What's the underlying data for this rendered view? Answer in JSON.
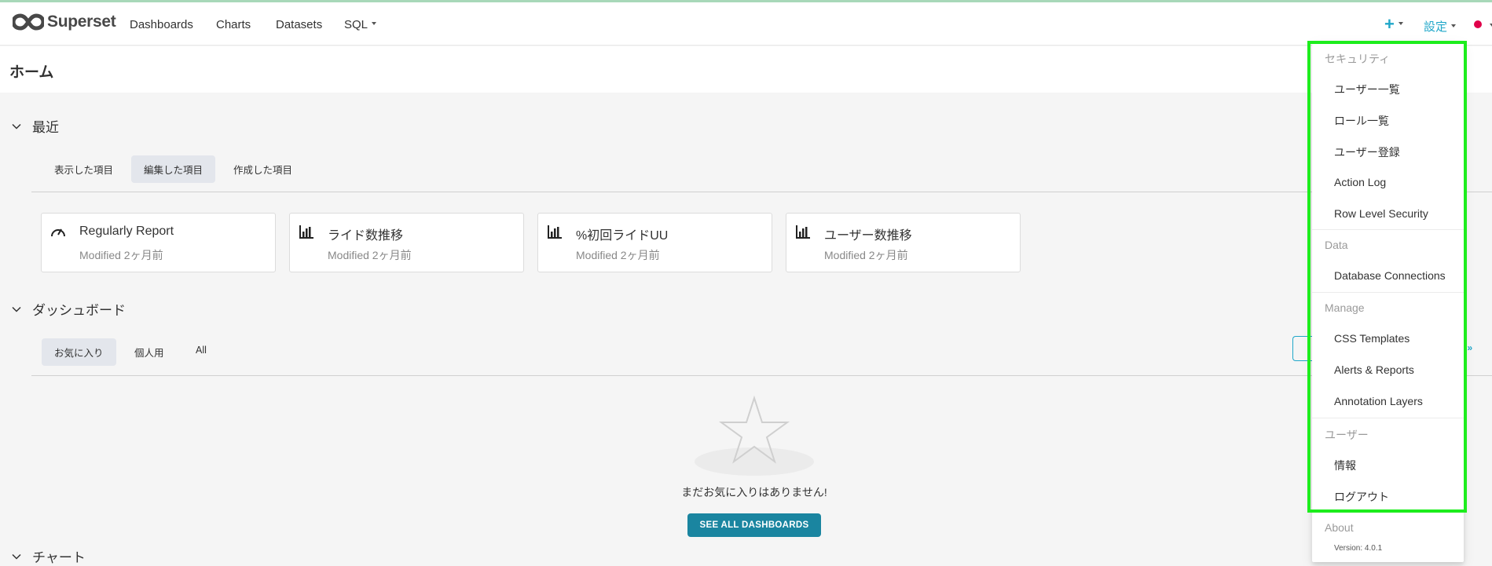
{
  "brand": {
    "name": "Superset"
  },
  "nav": {
    "items": [
      "Dashboards",
      "Charts",
      "Datasets",
      "SQL"
    ],
    "settings_label": "設定",
    "plus_label": "+"
  },
  "page": {
    "title": "ホーム"
  },
  "recent": {
    "heading": "最近",
    "tabs": [
      "表示した項目",
      "編集した項目",
      "作成した項目"
    ],
    "active_tab": "編集した項目",
    "cards": [
      {
        "icon": "dashboard-gauge-icon",
        "title": "Regularly Report",
        "subtitle": "Modified 2ヶ月前"
      },
      {
        "icon": "bar-chart-icon",
        "title": "ライド数推移",
        "subtitle": "Modified 2ヶ月前"
      },
      {
        "icon": "bar-chart-icon",
        "title": "%初回ライドUU",
        "subtitle": "Modified 2ヶ月前"
      },
      {
        "icon": "bar-chart-icon",
        "title": "ユーザー数推移",
        "subtitle": "Modified 2ヶ月前"
      }
    ]
  },
  "dashboards": {
    "heading": "ダッシュボード",
    "tabs": [
      "お気に入り",
      "個人用",
      "All"
    ],
    "active_tab": "お気に入り",
    "empty_text": "まだお気に入りはありません!",
    "see_all_label": "SEE ALL DASHBOARDS",
    "view_all_fragment": "L »"
  },
  "charts": {
    "heading": "チャート"
  },
  "settings_menu": {
    "groups": [
      {
        "label": "セキュリティ",
        "items": [
          "ユーザー一覧",
          "ロール一覧",
          "ユーザー登録",
          "Action Log",
          "Row Level Security"
        ]
      },
      {
        "label": "Data",
        "items": [
          "Database Connections"
        ]
      },
      {
        "label": "Manage",
        "items": [
          "CSS Templates",
          "Alerts & Reports",
          "Annotation Layers"
        ]
      },
      {
        "label": "ユーザー",
        "items": [
          "情報",
          "ログアウト"
        ]
      },
      {
        "label": "About",
        "items": []
      }
    ],
    "version": "Version: 4.0.1"
  },
  "colors": {
    "accent": "#20a7c9",
    "button": "#1a85a0",
    "highlight": "#1ded1d",
    "active_tab_bg": "#e3e6ec"
  }
}
